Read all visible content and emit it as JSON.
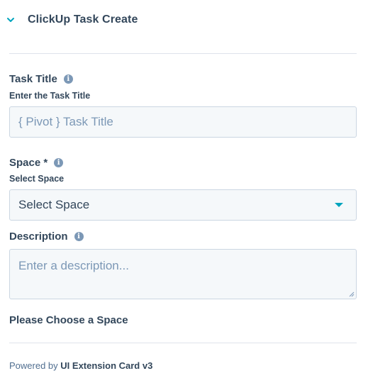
{
  "header": {
    "title": "ClickUp Task Create"
  },
  "task_title": {
    "label": "Task Title",
    "help": "Enter the Task Title",
    "placeholder": "{ Pivot } Task Title"
  },
  "space": {
    "label": "Space *",
    "help": "Select Space",
    "selected": "Select Space"
  },
  "description": {
    "label": "Description",
    "placeholder": "Enter a description..."
  },
  "message": "Please Choose a Space",
  "footer": {
    "prefix": "Powered by",
    "product": "UI Extension Card v3"
  },
  "colors": {
    "accent": "#00a4bd",
    "text": "#33475b",
    "muted": "#7c98b6",
    "field_bg": "#f5f8fa",
    "border": "#cbd6e2"
  }
}
